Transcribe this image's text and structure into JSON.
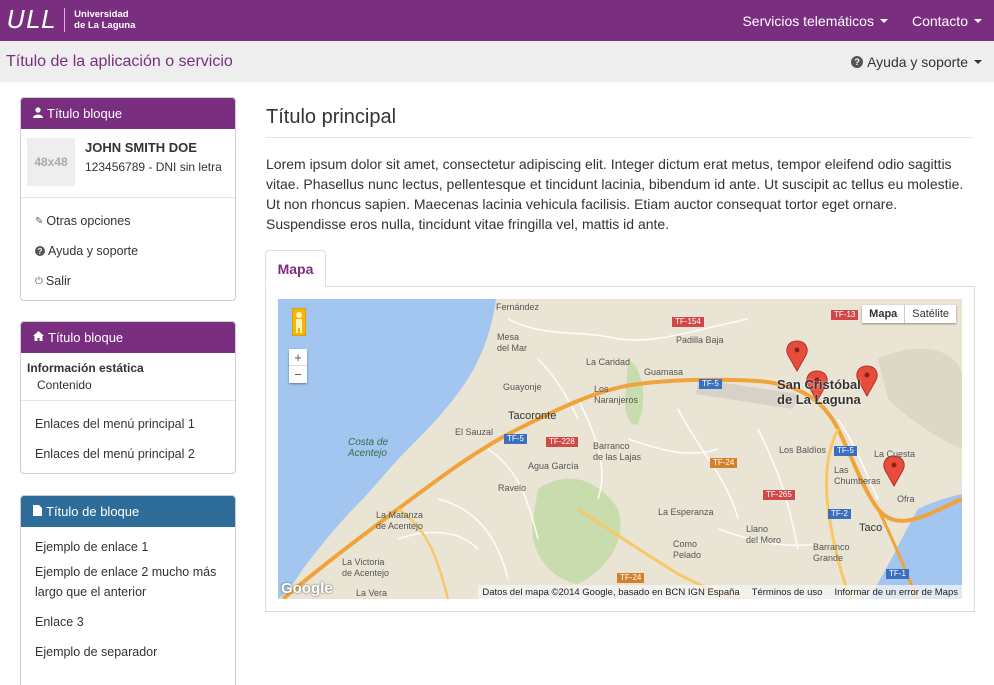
{
  "header": {
    "logo_mark": "ULL",
    "logo_line1": "Universidad",
    "logo_line2": "de La Laguna",
    "nav": [
      {
        "label": "Servicios telemáticos"
      },
      {
        "label": "Contacto"
      }
    ]
  },
  "appbar": {
    "title": "Título de la aplicación o servicio",
    "help_label": "Ayuda y soporte"
  },
  "sidebar": {
    "panel1": {
      "title": "Título bloque",
      "avatar_text": "48x48",
      "user_name": "JOHN SMITH DOE",
      "user_id": "123456789 - DNI sin letra",
      "items": [
        {
          "label": "Otras opciones",
          "icon": "pencil-icon"
        },
        {
          "label": "Ayuda y soporte",
          "icon": "question-icon"
        },
        {
          "label": "Salir",
          "icon": "power-icon"
        }
      ]
    },
    "panel2": {
      "title": "Título bloque",
      "static_title": "Información estática",
      "static_content": "Contenido",
      "items": [
        {
          "label": "Enlaces del menú principal 1"
        },
        {
          "label": "Enlaces del menú principal 2"
        }
      ]
    },
    "panel3": {
      "title": "Título de bloque",
      "items": [
        {
          "label": "Ejemplo de enlace 1"
        },
        {
          "label": "Ejemplo de enlace 2 mucho más"
        },
        {
          "label": "largo que el anterior"
        },
        {
          "label": "Enlace 3"
        },
        {
          "label": "Ejemplo de separador"
        }
      ]
    }
  },
  "main": {
    "title": "Título principal",
    "paragraph": "Lorem ipsum dolor sit amet, consectetur adipiscing elit. Integer dictum erat metus, tempor eleifend odio sagittis vitae. Phasellus nunc lectus, pellentesque et tincidunt lacinia, bibendum id ante. Ut suscipit ac tellus eu molestie. Ut non rhoncus sapien. Maecenas lacinia vehicula facilisis. Etiam auctor consequat tortor eget ornare. Suspendisse eros nulla, tincidunt vitae fringilla vel, mattis id ante.",
    "tab_label": "Mapa"
  },
  "map": {
    "btn_map": "Mapa",
    "btn_sat": "Satélite",
    "zoom_in": "+",
    "zoom_out": "−",
    "google": "Google",
    "footer_data": "Datos del mapa ©2014 Google, basado en BCN IGN España",
    "footer_terms": "Términos de uso",
    "footer_report": "Informar de un error de Maps",
    "places": {
      "fernandez": "Fernández",
      "mesa": "Mesa\ndel Mar",
      "caridad": "La Caridad",
      "padilla": "Padilla Baja",
      "guayonje": "Guayonje",
      "los_naranjeros": "Los\nNaranjeros",
      "guamasa": "Guamasa",
      "san_cristobal": "San Cristóbal\nde La Laguna",
      "tacoronte": "Tacoronte",
      "el_sauzal": "El Sauzal",
      "costa": "Costa de\nAcentejo",
      "barranco_lajas": "Barranco\nde las Lajas",
      "agua_garcia": "Agua García",
      "los_baldios": "Los Baldíos",
      "la_cuesta": "La Cuesta",
      "las_chumberas": "Las\nChumberas",
      "ofra": "Ofra",
      "ravelo": "Ravelo",
      "la_matanza": "La Matanza\nde Acentejo",
      "la_esperanza": "La Esperanza",
      "llano": "Llano\ndel Moro",
      "taco": "Taco",
      "barranco_grande": "Barranco\nGrande",
      "como": "Como\nPelado",
      "victoria": "La Victoria\nde Acentejo",
      "la_vera": "La Vera"
    },
    "roads": [
      "TF-154",
      "TF-13",
      "TF-5",
      "TF-5",
      "TF-228",
      "TF-24",
      "TF-5",
      "TF-265",
      "TF-2",
      "TF-1",
      "TF-24"
    ]
  },
  "colors": {
    "brand_purple": "#7a2e7f",
    "panel_blue": "#2e6c99",
    "appbar_bg": "#eeeeee"
  }
}
